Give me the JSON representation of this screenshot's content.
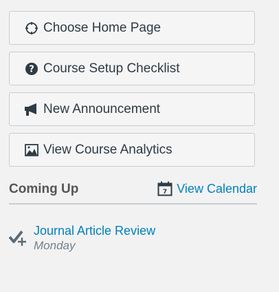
{
  "actions": [
    {
      "label": "Choose Home Page",
      "icon": "target-icon"
    },
    {
      "label": "Course Setup Checklist",
      "icon": "question-circle-icon"
    },
    {
      "label": "New Announcement",
      "icon": "megaphone-icon"
    },
    {
      "label": "View Course Analytics",
      "icon": "image-chart-icon"
    }
  ],
  "coming_up": {
    "title": "Coming Up",
    "view_calendar_label": "View Calendar",
    "calendar_icon_day": "7",
    "events": [
      {
        "title": "Journal Article Review",
        "date": "Monday",
        "icon": "assignment-icon"
      }
    ]
  },
  "colors": {
    "link": "#0081bd",
    "text": "#2d3b45",
    "border": "#c7cdd1",
    "muted": "#73818c"
  }
}
